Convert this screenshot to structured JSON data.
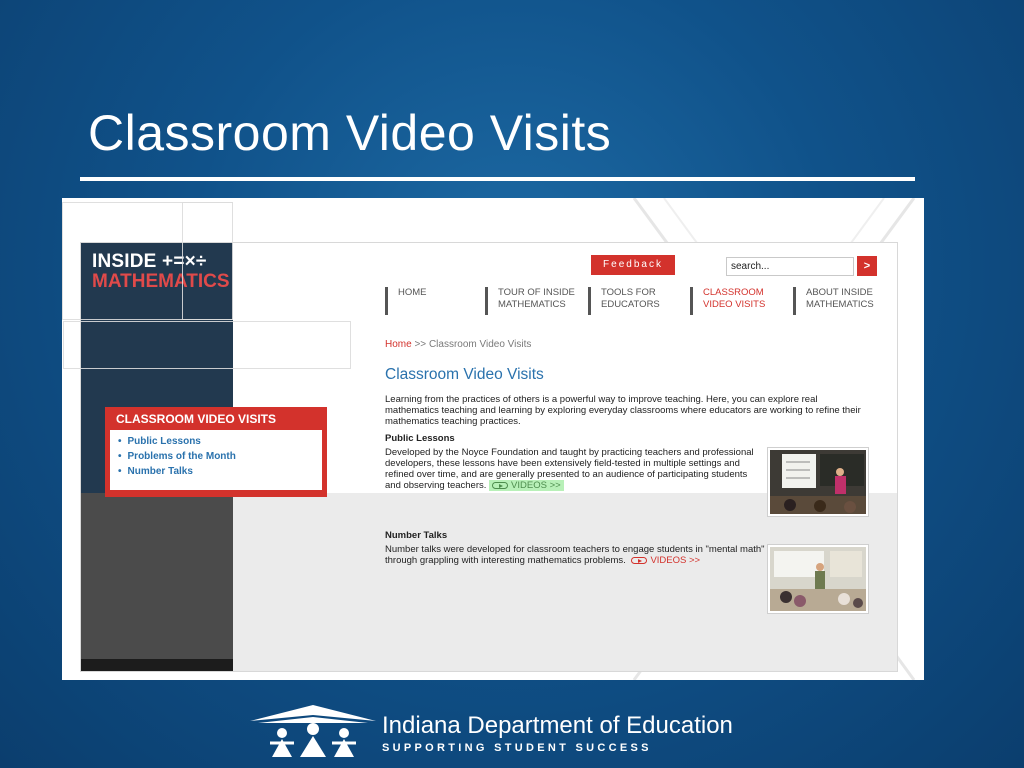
{
  "slide": {
    "title": "Classroom Video Visits"
  },
  "site": {
    "logo": {
      "line1": "INSIDE +=×÷",
      "line2": "MATHEMATICS"
    },
    "feedback_label": "Feedback",
    "search": {
      "placeholder": "search...",
      "go_label": ">"
    },
    "nav": [
      {
        "line1": "HOME",
        "line2": "",
        "active": false
      },
      {
        "line1": "TOUR OF INSIDE",
        "line2": "MATHEMATICS",
        "active": false
      },
      {
        "line1": "TOOLS FOR",
        "line2": "EDUCATORS",
        "active": false
      },
      {
        "line1": "CLASSROOM",
        "line2": "VIDEO VISITS",
        "active": true
      },
      {
        "line1": "ABOUT INSIDE",
        "line2": "MATHEMATICS",
        "active": false
      }
    ],
    "breadcrumb": {
      "home": "Home",
      "separator": ">>",
      "current": "Classroom Video Visits"
    },
    "page_title": "Classroom Video Visits",
    "intro": "Learning from the practices of others is a powerful way to improve teaching. Here, you can explore real mathematics teaching and learning by exploring everyday classrooms where educators are working to refine their mathematics teaching practices.",
    "sections": [
      {
        "heading": "Public Lessons",
        "body": "Developed by the Noyce Foundation and taught by practicing teachers and professional developers, these lessons have been extensively field-tested in multiple settings and refined over time, and are generally presented to an audience of participating students and observing teachers.",
        "link": "VIDEOS >>"
      },
      {
        "heading": "Number Talks",
        "body": "Number talks were developed for classroom teachers to engage students in \"mental math\" through grappling with interesting mathematics problems.",
        "link": "VIDEOS >>"
      }
    ]
  },
  "callout": {
    "title": "CLASSROOM VIDEO VISITS",
    "items": [
      "Public Lessons",
      "Problems of the Month",
      "Number Talks"
    ]
  },
  "footer": {
    "org_name": "Indiana Department of Education",
    "tagline": "SUPPORTING STUDENT SUCCESS"
  },
  "colors": {
    "accent_red": "#d3322c",
    "link_blue": "#2a72ad",
    "slide_blue": "#10528a",
    "highlight_green": "#b8f0b8"
  },
  "icons": [
    "play-icon",
    "search-go-icon",
    "indiana-doe-logo-icon"
  ]
}
